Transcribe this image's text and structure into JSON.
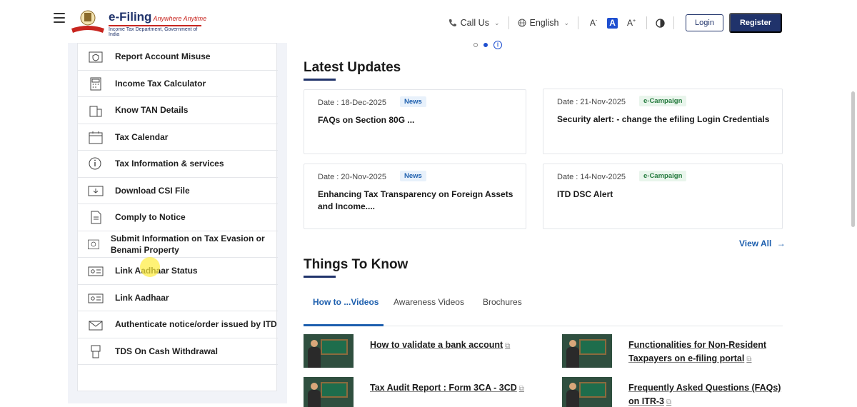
{
  "header": {
    "logo_title": "e-Filing",
    "logo_tagline": "Anywhere Anytime",
    "logo_subtitle": "Income Tax Department, Government of India",
    "call_us": "Call Us",
    "language": "English",
    "font_decrease": "A",
    "font_normal": "A",
    "font_increase": "A",
    "login": "Login",
    "register": "Register"
  },
  "sidebar": {
    "items": [
      {
        "label": "Report Account Misuse",
        "icon": "shield-icon"
      },
      {
        "label": "Income Tax Calculator",
        "icon": "calculator-icon"
      },
      {
        "label": "Know TAN Details",
        "icon": "building-icon"
      },
      {
        "label": "Tax Calendar",
        "icon": "calendar-icon"
      },
      {
        "label": "Tax Information & services",
        "icon": "info-icon"
      },
      {
        "label": "Download CSI File",
        "icon": "download-icon"
      },
      {
        "label": "Comply to Notice",
        "icon": "document-icon"
      },
      {
        "label": "Submit Information on Tax Evasion or Benami Property",
        "icon": "evasion-icon"
      },
      {
        "label": "Link Aadhaar Status",
        "icon": "id-card-icon"
      },
      {
        "label": "Link Aadhaar",
        "icon": "id-card-icon"
      },
      {
        "label": "Authenticate notice/order issued by ITD",
        "icon": "envelope-icon"
      },
      {
        "label": "TDS On Cash Withdrawal",
        "icon": "cash-icon"
      }
    ]
  },
  "latest_updates": {
    "title": "Latest Updates",
    "view_all": "View All",
    "cards": [
      {
        "date": "Date : 18-Dec-2025",
        "badge": "News",
        "title": "FAQs on Section 80G ..."
      },
      {
        "date": "Date : 21-Nov-2025",
        "badge": "e-Campaign",
        "title": "Security alert: - change the efiling Login Credentials"
      },
      {
        "date": "Date : 20-Nov-2025",
        "badge": "News",
        "title": "Enhancing Tax Transparency on Foreign Assets and Income...."
      },
      {
        "date": "Date : 14-Nov-2025",
        "badge": "e-Campaign",
        "title": "ITD DSC Alert"
      }
    ]
  },
  "things_to_know": {
    "title": "Things To Know",
    "tabs": [
      "How to ...Videos",
      "Awareness Videos",
      "Brochures"
    ],
    "videos": [
      {
        "title": "How to validate a bank account"
      },
      {
        "title": "Functionalities for Non-Resident Taxpayers on e-filing portal"
      },
      {
        "title": "Tax Audit Report : Form 3CA - 3CD"
      },
      {
        "title": "Frequently Asked Questions (FAQs) on ITR-3"
      }
    ]
  },
  "colors": {
    "brand_navy": "#20336b",
    "accent_blue": "#1d5fae",
    "logo_red": "#c8251f"
  }
}
